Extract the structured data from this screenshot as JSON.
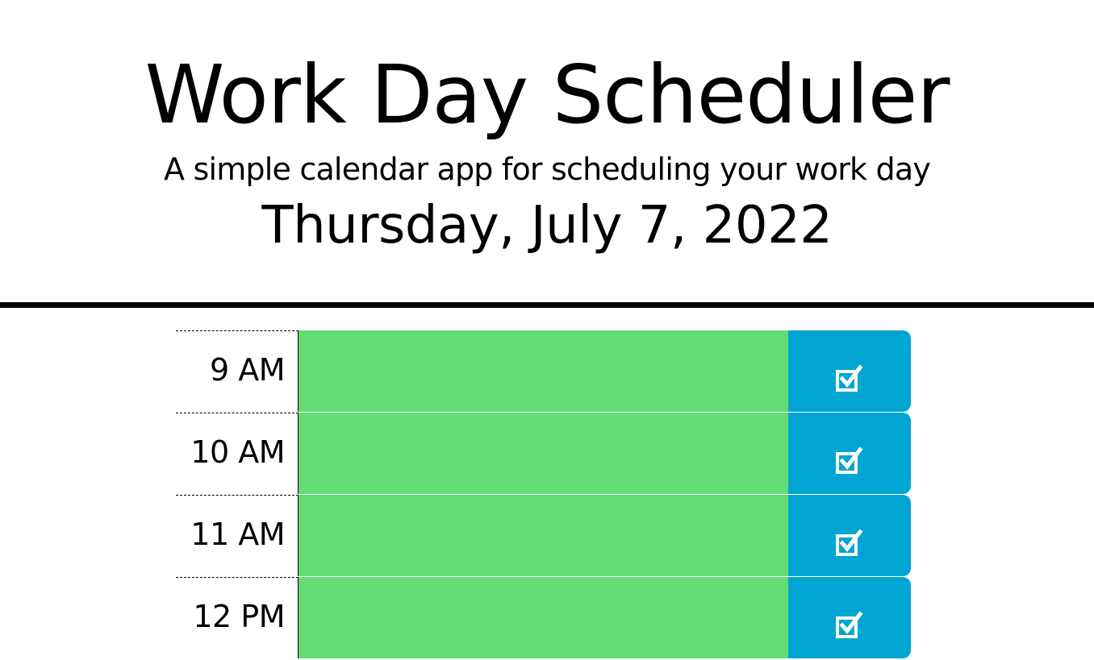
{
  "header": {
    "title": "Work Day Scheduler",
    "subtitle": "A simple calendar app for scheduling your work day",
    "current_day": "Thursday, July 7, 2022"
  },
  "colors": {
    "present_slot": "#64db75",
    "save_button": "#01a5d2"
  },
  "time_blocks": [
    {
      "hour": "9 AM",
      "description": "",
      "save_icon": "checkbox-icon"
    },
    {
      "hour": "10 AM",
      "description": "",
      "save_icon": "checkbox-icon"
    },
    {
      "hour": "11 AM",
      "description": "",
      "save_icon": "checkbox-icon"
    },
    {
      "hour": "12 PM",
      "description": "",
      "save_icon": "checkbox-icon"
    }
  ]
}
